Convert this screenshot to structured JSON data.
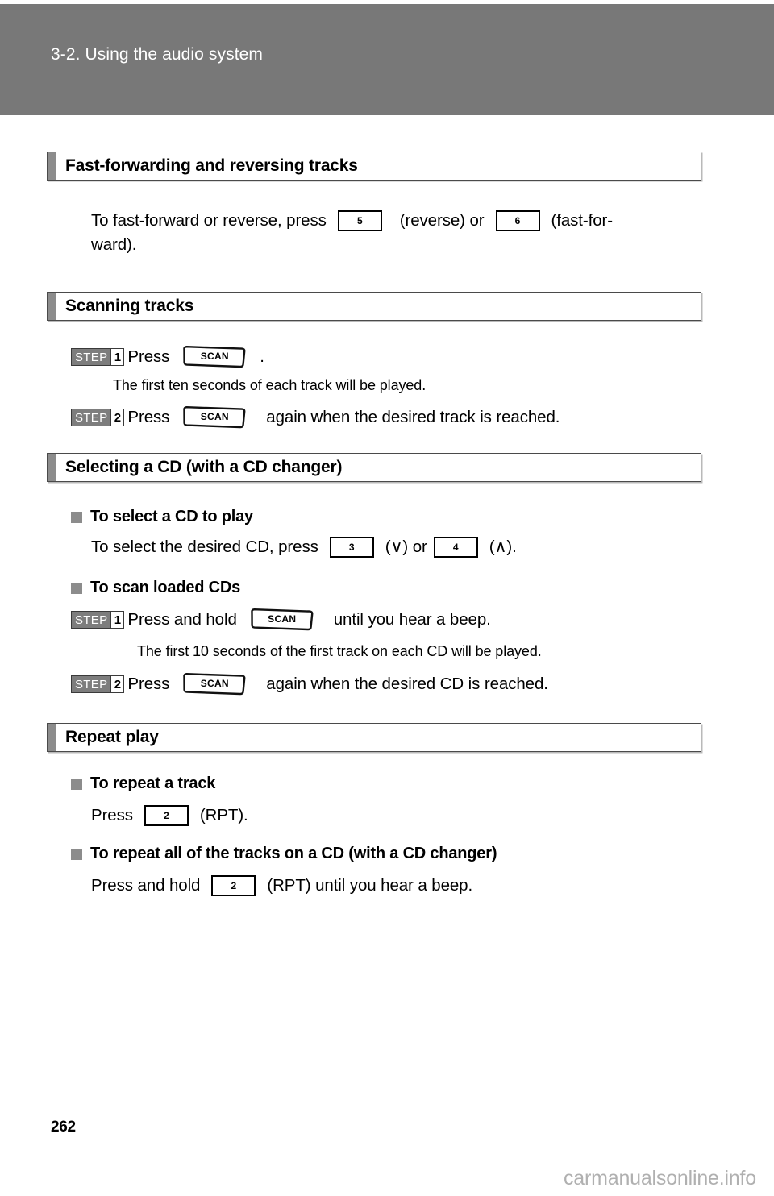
{
  "header": {
    "chapter_title": "3-2. Using the audio system"
  },
  "sections": [
    {
      "id": "fast-forwarding",
      "title": "Fast-forwarding and reversing tracks",
      "intro_a": "To fast-forward or reverse, press",
      "key_1": "5",
      "mid_a": "(reverse) or",
      "key_2": "6",
      "tail_a": "(fast-for-",
      "line_2": "ward)."
    },
    {
      "id": "scanning-tracks",
      "title": "Scanning tracks",
      "step1_word": "STEP",
      "step1_num": "1",
      "step1_text": "Press",
      "step1_button": "SCAN",
      "step1_period": ".",
      "step1_note": "The first ten seconds of each track will be played.",
      "step2_word": "STEP",
      "step2_num": "2",
      "step2_text": "Press",
      "step2_button": "SCAN",
      "step2_tail": "again when the desired track is reached."
    },
    {
      "id": "selecting-cd",
      "title": "Selecting a CD (with a CD changer)",
      "sub1_title": "To select a CD to play",
      "sub1_lead": "To select the desired CD, press",
      "sub1_key_1": "3",
      "sub1_mid": "(∨) or",
      "sub1_key_2": "4",
      "sub1_tail": "(∧).",
      "sub2_title": "To scan loaded CDs",
      "sub2_step1_word": "STEP",
      "sub2_step1_num": "1",
      "sub2_step1_text": "Press and hold",
      "sub2_step1_button": "SCAN",
      "sub2_step1_tail": "until you hear a beep.",
      "sub2_step1_note": "The first 10 seconds of the first track on each CD will be played.",
      "sub2_step2_word": "STEP",
      "sub2_step2_num": "2",
      "sub2_step2_text": "Press",
      "sub2_step2_button": "SCAN",
      "sub2_step2_tail": "again when the desired CD is reached."
    },
    {
      "id": "repeat-play",
      "title": "Repeat play",
      "sub1_title": "To repeat a track",
      "sub1_lead": "Press",
      "sub1_key": "2",
      "sub1_tail": "(RPT).",
      "sub2_title": "To repeat all of the tracks on a CD (with a CD changer)",
      "sub2_lead": "Press and hold",
      "sub2_key": "2",
      "sub2_tail": "(RPT) until you hear a beep."
    }
  ],
  "footer": {
    "page_number": "262",
    "watermark": "carmanualsonline.info"
  },
  "colors": {
    "header_bar": "#787878",
    "section_tab": "#8c8c8c",
    "step_badge": "#7d7d7d",
    "watermark": "#b0b0b0"
  }
}
